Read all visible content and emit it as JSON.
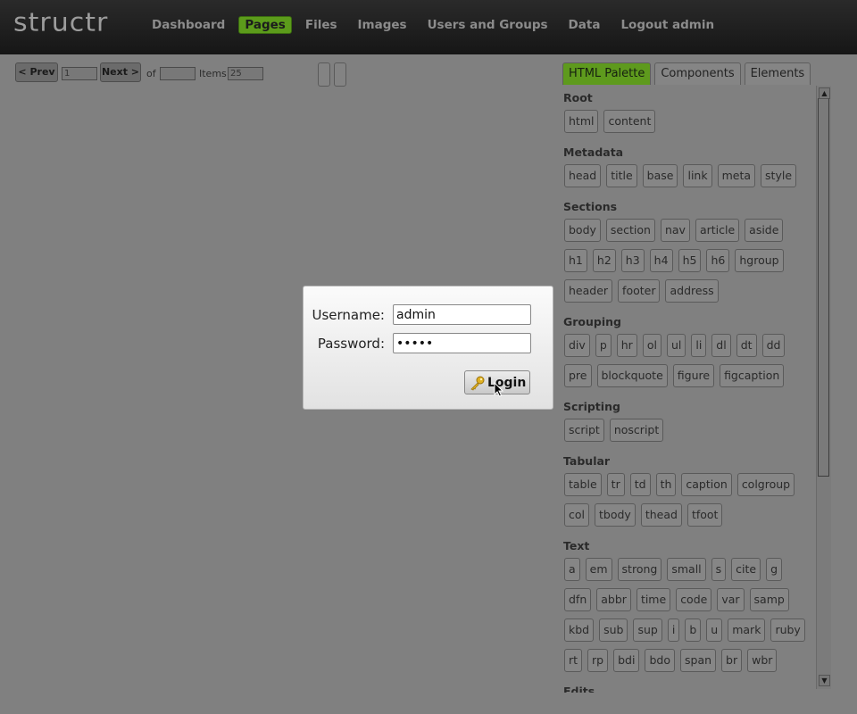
{
  "app": {
    "logo": "structr"
  },
  "nav": {
    "items": [
      "Dashboard",
      "Pages",
      "Files",
      "Images",
      "Users and Groups",
      "Data",
      "Logout admin"
    ],
    "active": "Pages"
  },
  "pager": {
    "prev_label": "< Prev",
    "page_value": "1",
    "next_label": "Next >",
    "of_label": "of",
    "of_value": "",
    "items_label": "Items:",
    "items_value": "25"
  },
  "palette": {
    "tabs": [
      "HTML Palette",
      "Components",
      "Elements"
    ],
    "active_tab": "HTML Palette",
    "sections": [
      {
        "title": "Root",
        "tags": [
          "html",
          "content"
        ]
      },
      {
        "title": "Metadata",
        "tags": [
          "head",
          "title",
          "base",
          "link",
          "meta",
          "style"
        ]
      },
      {
        "title": "Sections",
        "tags": [
          "body",
          "section",
          "nav",
          "article",
          "aside",
          "h1",
          "h2",
          "h3",
          "h4",
          "h5",
          "h6",
          "hgroup",
          "header",
          "footer",
          "address"
        ]
      },
      {
        "title": "Grouping",
        "tags": [
          "div",
          "p",
          "hr",
          "ol",
          "ul",
          "li",
          "dl",
          "dt",
          "dd",
          "pre",
          "blockquote",
          "figure",
          "figcaption"
        ]
      },
      {
        "title": "Scripting",
        "tags": [
          "script",
          "noscript"
        ]
      },
      {
        "title": "Tabular",
        "tags": [
          "table",
          "tr",
          "td",
          "th",
          "caption",
          "colgroup",
          "col",
          "tbody",
          "thead",
          "tfoot"
        ]
      },
      {
        "title": "Text",
        "tags": [
          "a",
          "em",
          "strong",
          "small",
          "s",
          "cite",
          "g",
          "dfn",
          "abbr",
          "time",
          "code",
          "var",
          "samp",
          "kbd",
          "sub",
          "sup",
          "i",
          "b",
          "u",
          "mark",
          "ruby",
          "rt",
          "rp",
          "bdi",
          "bdo",
          "span",
          "br",
          "wbr"
        ]
      },
      {
        "title": "Edits",
        "tags": []
      }
    ]
  },
  "login": {
    "username_label": "Username:",
    "username_value": "admin",
    "password_label": "Password:",
    "password_value": "•••••",
    "button_label": "Login"
  },
  "colors": {
    "accent": "#5c9b1b",
    "overlay": "#808080",
    "topbar": "#1e1e1e"
  }
}
